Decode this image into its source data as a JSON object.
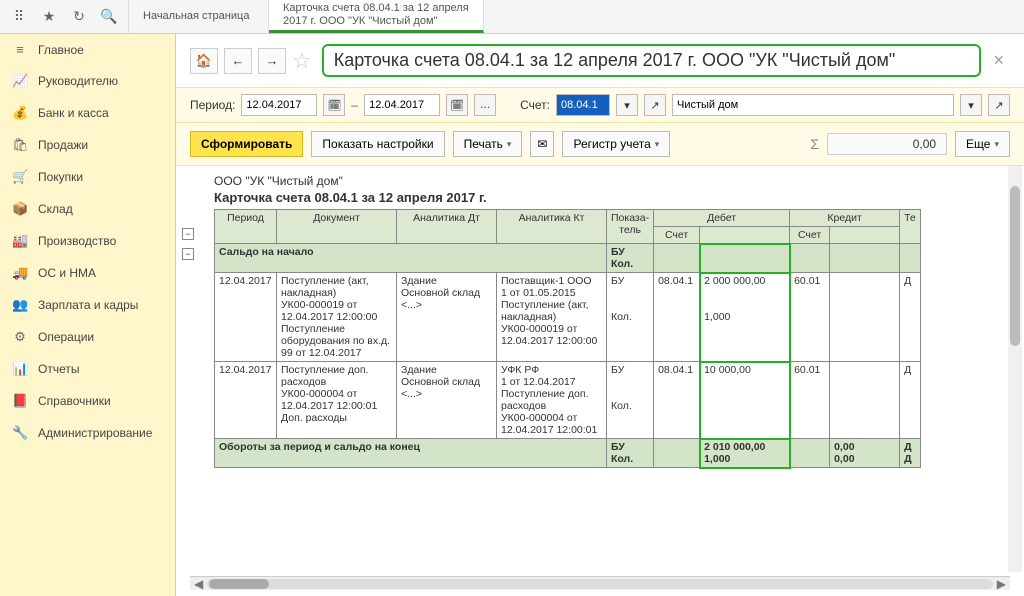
{
  "topbar": {
    "tabs": [
      {
        "line1": "Начальная страница",
        "line2": ""
      },
      {
        "line1": "Карточка счета 08.04.1 за 12 апреля",
        "line2": "2017 г. ООО \"УК \"Чистый дом\""
      }
    ]
  },
  "sidebar": {
    "items": [
      {
        "icon": "≡",
        "label": "Главное"
      },
      {
        "icon": "📈",
        "label": "Руководителю"
      },
      {
        "icon": "💰",
        "label": "Банк и касса"
      },
      {
        "icon": "🛍",
        "label": "Продажи"
      },
      {
        "icon": "🛒",
        "label": "Покупки"
      },
      {
        "icon": "📦",
        "label": "Склад"
      },
      {
        "icon": "🏭",
        "label": "Производство"
      },
      {
        "icon": "🚚",
        "label": "ОС и НМА"
      },
      {
        "icon": "👥",
        "label": "Зарплата и кадры"
      },
      {
        "icon": "⚙",
        "label": "Операции"
      },
      {
        "icon": "📊",
        "label": "Отчеты"
      },
      {
        "icon": "📕",
        "label": "Справочники"
      },
      {
        "icon": "🔧",
        "label": "Администрирование"
      }
    ]
  },
  "page": {
    "title": "Карточка счета 08.04.1 за 12 апреля 2017 г. ООО \"УК \"Чистый дом\""
  },
  "params": {
    "period_label": "Период:",
    "date_from": "12.04.2017",
    "date_to": "12.04.2017",
    "account_label": "Счет:",
    "account": "08.04.1",
    "org": "Чистый дом"
  },
  "toolbar": {
    "form": "Сформировать",
    "show_settings": "Показать настройки",
    "print": "Печать",
    "register": "Регистр учета",
    "sigma": "Σ",
    "sum": "0,00",
    "more": "Еще"
  },
  "report": {
    "org": "ООО \"УК \"Чистый дом\"",
    "title": "Карточка счета 08.04.1 за 12 апреля 2017 г.",
    "headers": {
      "period": "Период",
      "document": "Документ",
      "an_dt": "Аналитика Дт",
      "an_kt": "Аналитика Кт",
      "indicator": "Показа-\nтель",
      "debit": "Дебет",
      "credit": "Кредит",
      "t": "Те",
      "schet": "Счет"
    },
    "saldo_start": "Сальдо на начало",
    "indicator_bu": "БУ",
    "indicator_kol": "Кол.",
    "rows": [
      {
        "period": "12.04.2017",
        "document": "Поступление (акт, накладная)\nУК00-000019 от 12.04.2017 12:00:00\nПоступление оборудования по вх.д. 99 от 12.04.2017",
        "an_dt": "Здание\nОсновной склад\n<...>",
        "an_kt": "Поставщик-1 ООО\n1 от 01.05.2015\nПоступление (акт, накладная)\nУК00-000019 от 12.04.2017 12:00:00",
        "dt_schet": "08.04.1",
        "bu_val": "2 000 000,00",
        "kol_val": "1,000",
        "kt_schet": "60.01",
        "t": "Д"
      },
      {
        "period": "12.04.2017",
        "document": "Поступление доп. расходов\nУК00-000004 от 12.04.2017 12:00:01\nДоп. расходы",
        "an_dt": "Здание\nОсновной склад\n<...>",
        "an_kt": "УФК РФ\n1 от 12.04.2017\nПоступление доп. расходов\nУК00-000004 от 12.04.2017 12:00:01",
        "dt_schet": "08.04.1",
        "bu_val": "10 000,00",
        "kol_val": "",
        "kt_schet": "60.01",
        "t": "Д"
      }
    ],
    "totals": {
      "label": "Обороты за период и сальдо на конец",
      "bu_debit": "2 010 000,00",
      "kol_debit": "1,000",
      "bu_credit": "0,00",
      "kol_credit": "0,00",
      "t1": "Д",
      "t2": "Д"
    }
  }
}
